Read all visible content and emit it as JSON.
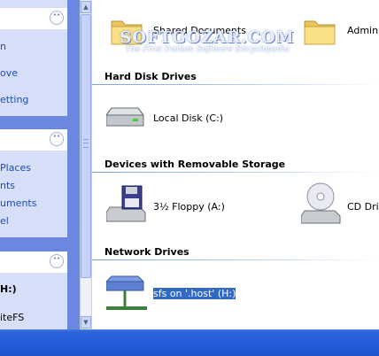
{
  "left_panel": {
    "panel1": {
      "items": [
        "n",
        "ove",
        "etting"
      ]
    },
    "panel2": {
      "items": [
        "Places",
        "nts",
        "uments",
        "el"
      ]
    },
    "panel3": {
      "items": [
        "H:)",
        "iteFS"
      ]
    }
  },
  "sections": [
    {
      "header": "Hard Disk Drives"
    },
    {
      "header": "Devices with Removable Storage"
    },
    {
      "header": "Network Drives"
    }
  ],
  "items": {
    "shared_documents": "Shared Documents",
    "admin_docs": "Adminis",
    "local_disk": "Local Disk (C:)",
    "floppy": "3½ Floppy (A:)",
    "cd_drive": "CD Driv",
    "network_drive": "sfs on '.host' (H:)"
  },
  "watermark": {
    "line1": "SOFTGOZAR.COM",
    "line2": "The First Iranian Software Encyclopedia"
  },
  "colors": {
    "task_pane": "#6b87df",
    "panel_body": "#d6dff7",
    "selection": "#316ac5",
    "taskbar": "#245edc"
  }
}
